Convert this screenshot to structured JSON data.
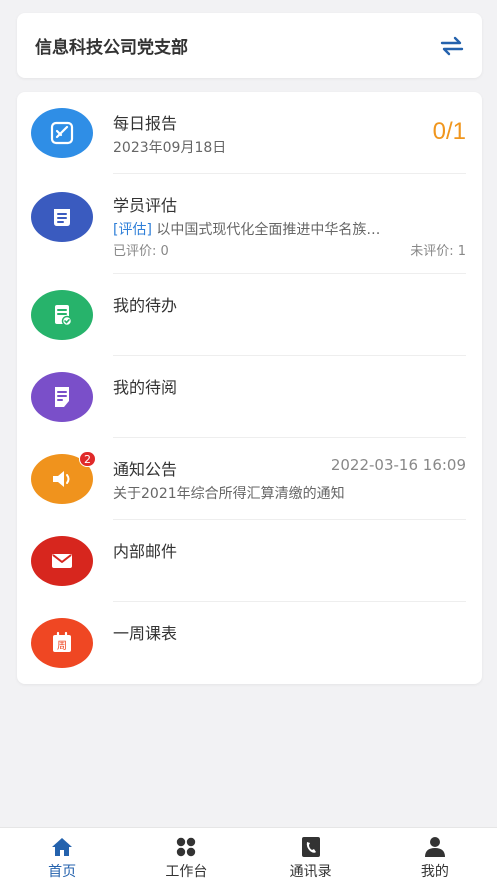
{
  "org": {
    "name": "信息科技公司党支部"
  },
  "colors": {
    "accent": "#2462ad",
    "count": "#f0961e",
    "tag": "#2f7fd8",
    "badge": "#e02a2a"
  },
  "items": [
    {
      "title": "每日报告",
      "date": "2023年09月18日",
      "count": "0/1",
      "icon": "report-icon",
      "color": "#2f8ee6"
    },
    {
      "title": "学员评估",
      "tag": "[评估]",
      "desc": "以中国式现代化全面推进中华名族…",
      "evaluated": "已评价: 0",
      "not_evaluated": "未评价: 1",
      "icon": "evaluation-icon",
      "color": "#3a5bbf"
    },
    {
      "title": "我的待办",
      "icon": "todo-icon",
      "color": "#27b36b"
    },
    {
      "title": "我的待阅",
      "icon": "to-read-icon",
      "color": "#7a4fc9"
    },
    {
      "title": "通知公告",
      "time": "2022-03-16 16:09",
      "desc": "关于2021年综合所得汇算清缴的通知",
      "badge": "2",
      "icon": "announcement-icon",
      "color": "#f0931d"
    },
    {
      "title": "内部邮件",
      "icon": "mail-icon",
      "color": "#d7261e"
    },
    {
      "title": "一周课表",
      "icon": "calendar-icon",
      "calendar_glyph": "周",
      "color": "#ef4723"
    }
  ],
  "tabs": [
    {
      "label": "首页",
      "icon": "home-icon",
      "active": true
    },
    {
      "label": "工作台",
      "icon": "workbench-icon",
      "active": false
    },
    {
      "label": "通讯录",
      "icon": "contacts-icon",
      "active": false
    },
    {
      "label": "我的",
      "icon": "profile-icon",
      "active": false
    }
  ]
}
